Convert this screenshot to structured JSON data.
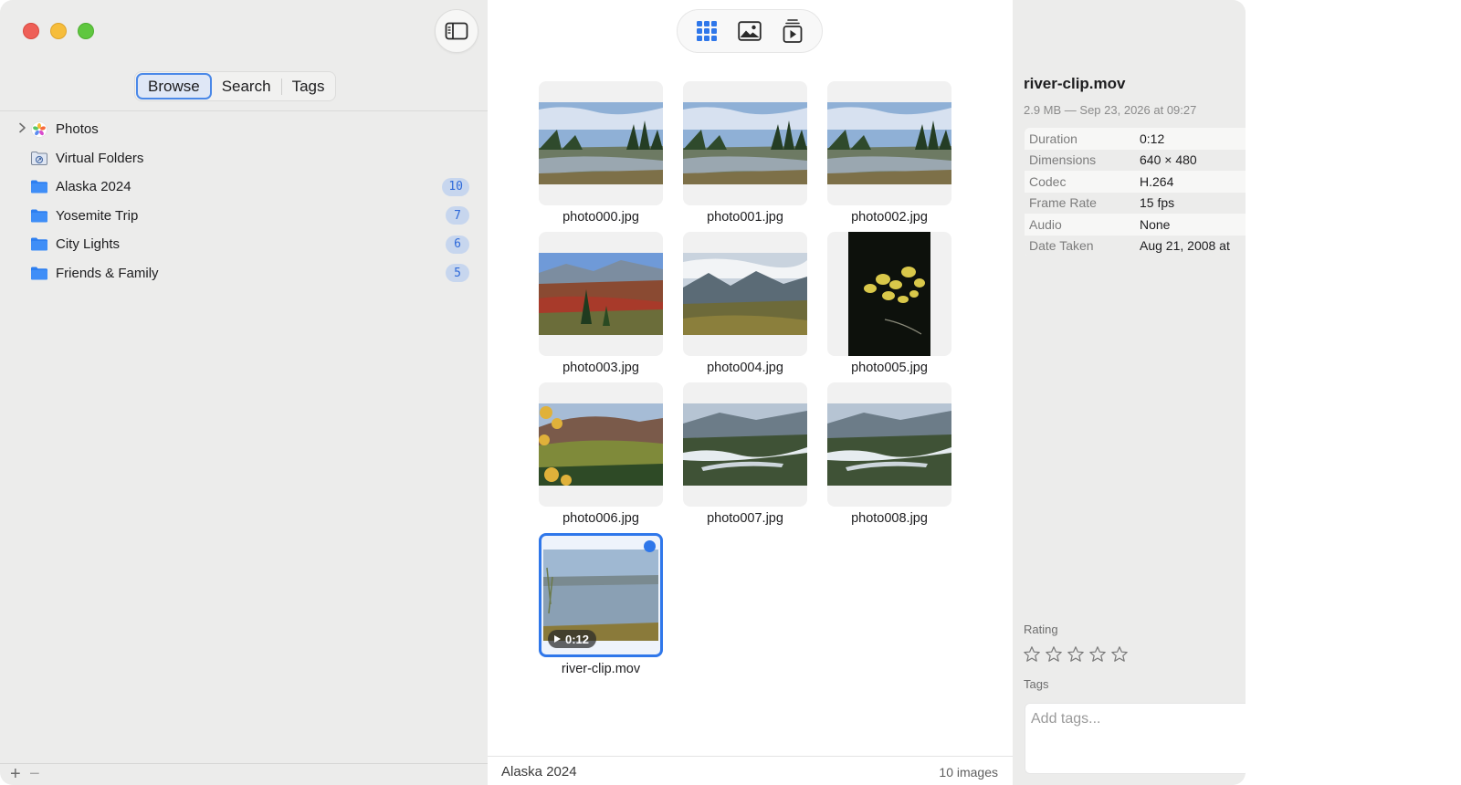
{
  "sidebar": {
    "tabs": [
      {
        "label": "Browse",
        "active": true
      },
      {
        "label": "Search",
        "active": false
      },
      {
        "label": "Tags",
        "active": false
      }
    ],
    "items": [
      {
        "label": "Photos",
        "icon": "photos-icon",
        "badge": "",
        "expandable": true
      },
      {
        "label": "Virtual Folders",
        "icon": "virtual-folder-icon",
        "badge": "",
        "expandable": false
      },
      {
        "label": "Alaska 2024",
        "icon": "folder-icon",
        "badge": "10",
        "expandable": false
      },
      {
        "label": "Yosemite Trip",
        "icon": "folder-icon",
        "badge": "7",
        "expandable": false
      },
      {
        "label": "City Lights",
        "icon": "folder-icon",
        "badge": "6",
        "expandable": false
      },
      {
        "label": "Friends & Family",
        "icon": "folder-icon",
        "badge": "5",
        "expandable": false
      }
    ],
    "add_label": "+",
    "remove_label": "−"
  },
  "toolbar": {
    "views": [
      {
        "icon": "grid-view-icon",
        "active": true
      },
      {
        "icon": "single-image-view-icon",
        "active": false
      },
      {
        "icon": "slideshow-icon",
        "active": false
      }
    ]
  },
  "grid": {
    "items": [
      {
        "name": "photo000.jpg",
        "scene": "river"
      },
      {
        "name": "photo001.jpg",
        "scene": "river"
      },
      {
        "name": "photo002.jpg",
        "scene": "river"
      },
      {
        "name": "photo003.jpg",
        "scene": "tundra"
      },
      {
        "name": "photo004.jpg",
        "scene": "valley"
      },
      {
        "name": "photo005.jpg",
        "scene": "leaves",
        "portrait": true
      },
      {
        "name": "photo006.jpg",
        "scene": "hills"
      },
      {
        "name": "photo007.jpg",
        "scene": "braided"
      },
      {
        "name": "photo008.jpg",
        "scene": "braided"
      },
      {
        "name": "river-clip.mov",
        "scene": "lake",
        "selected": true,
        "duration": "0:12"
      }
    ]
  },
  "status": {
    "folder": "Alaska 2024",
    "count": "10 images"
  },
  "inspector": {
    "title": "river-clip.mov",
    "subtitle": "2.9 MB — Sep 23, 2026 at 09:27",
    "metadata": [
      {
        "key": "Duration",
        "value": "0:12"
      },
      {
        "key": "Dimensions",
        "value": "640 × 480"
      },
      {
        "key": "Codec",
        "value": "H.264"
      },
      {
        "key": "Frame Rate",
        "value": "15 fps"
      },
      {
        "key": "Audio",
        "value": "None"
      },
      {
        "key": "Date Taken",
        "value": "Aug 21, 2008 at"
      }
    ],
    "rating_label": "Rating",
    "rating": 0,
    "tags_label": "Tags",
    "tags_placeholder": "Add tags..."
  },
  "colors": {
    "accent": "#2f77ea",
    "badge_bg": "#c7d6ee",
    "close": "#ee5f57",
    "minimize": "#f6bd3b",
    "maximize": "#5fc73f"
  }
}
